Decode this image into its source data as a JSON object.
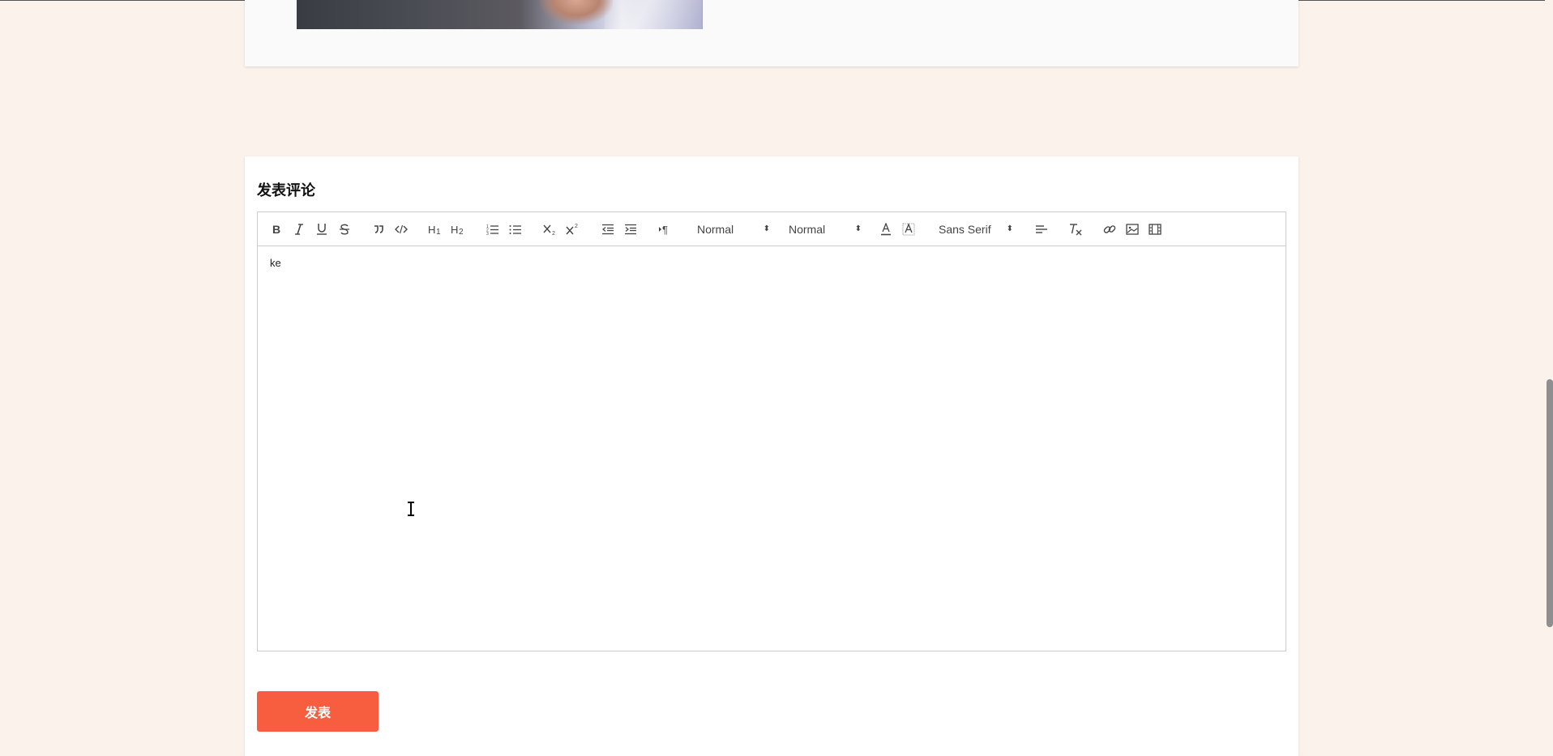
{
  "comment_section": {
    "title": "发表评论",
    "submit_label": "发表"
  },
  "editor": {
    "content": "ke",
    "toolbar": {
      "buttons": [
        {
          "name": "bold-button",
          "icon": "bold-icon",
          "glyph": "B"
        },
        {
          "name": "italic-button",
          "icon": "italic-icon",
          "glyph": "I"
        },
        {
          "name": "underline-button",
          "icon": "underline-icon",
          "glyph": "U"
        },
        {
          "name": "strike-button",
          "icon": "strikethrough-icon",
          "glyph": "S"
        },
        {
          "name": "blockquote-button",
          "icon": "quote-icon",
          "glyph": "❞"
        },
        {
          "name": "code-block-button",
          "icon": "code-icon",
          "glyph": "</>"
        },
        {
          "name": "header1-button",
          "icon": "h1-icon",
          "glyph": "H1"
        },
        {
          "name": "header2-button",
          "icon": "h2-icon",
          "glyph": "H2"
        },
        {
          "name": "ordered-list-button",
          "icon": "ordered-list-icon",
          "glyph": "ol"
        },
        {
          "name": "bullet-list-button",
          "icon": "bullet-list-icon",
          "glyph": "ul"
        },
        {
          "name": "subscript-button",
          "icon": "subscript-icon",
          "glyph": "x₂"
        },
        {
          "name": "superscript-button",
          "icon": "superscript-icon",
          "glyph": "x²"
        },
        {
          "name": "outdent-button",
          "icon": "outdent-icon",
          "glyph": "out"
        },
        {
          "name": "indent-button",
          "icon": "indent-icon",
          "glyph": "in"
        },
        {
          "name": "text-direction-button",
          "icon": "rtl-icon",
          "glyph": "¶"
        },
        {
          "name": "font-color-button",
          "icon": "font-color-icon",
          "glyph": "A"
        },
        {
          "name": "background-color-button",
          "icon": "background-color-icon",
          "glyph": "A"
        },
        {
          "name": "align-button",
          "icon": "align-left-icon",
          "glyph": "≡"
        },
        {
          "name": "clean-button",
          "icon": "clear-format-icon",
          "glyph": "Tx"
        },
        {
          "name": "link-button",
          "icon": "link-icon",
          "glyph": "link"
        },
        {
          "name": "image-button",
          "icon": "image-icon",
          "glyph": "img"
        },
        {
          "name": "video-button",
          "icon": "video-icon",
          "glyph": "vid"
        }
      ],
      "size_picker": "Normal",
      "header_picker": "Normal",
      "font_picker": "Sans Serif"
    }
  },
  "colors": {
    "page_background": "#fbf3eb",
    "submit_button": "#f65e3f"
  }
}
